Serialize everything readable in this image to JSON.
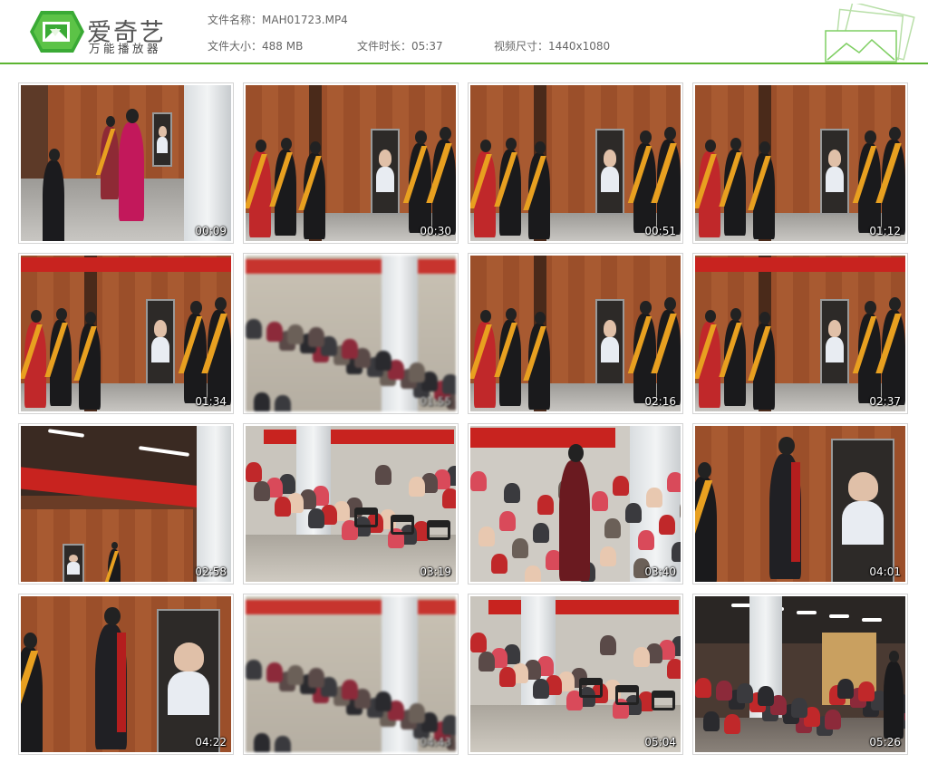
{
  "app": {
    "title": "爱奇艺",
    "subtitle": "万能播放器"
  },
  "file": {
    "name_label": "文件名称：",
    "name": "MAH01723.MP4",
    "size_label": "文件大小：",
    "size": "488 MB",
    "duration_label": "文件时长：",
    "duration": "05:37",
    "dimensions_label": "视频尺寸：",
    "dimensions": "1440x1080"
  },
  "colors": {
    "accent": "#5cb531",
    "logo_green": "#3aaa35",
    "banner_red": "#c8231f",
    "wall_wood": "#a0522d"
  },
  "thumbnails": [
    {
      "time": "00:09",
      "scene": "entrance-walk"
    },
    {
      "time": "00:30",
      "scene": "clapping-line"
    },
    {
      "time": "00:51",
      "scene": "clapping-line"
    },
    {
      "time": "01:12",
      "scene": "clapping-line"
    },
    {
      "time": "01:34",
      "scene": "clapping-line-banner"
    },
    {
      "time": "01:55",
      "scene": "blurred-hall"
    },
    {
      "time": "02:16",
      "scene": "clapping-line"
    },
    {
      "time": "02:37",
      "scene": "clapping-line-banner"
    },
    {
      "time": "02:58",
      "scene": "tilted-ceiling"
    },
    {
      "time": "03:19",
      "scene": "seated-audience"
    },
    {
      "time": "03:40",
      "scene": "man-in-crowd"
    },
    {
      "time": "04:01",
      "scene": "man-high-five"
    },
    {
      "time": "04:22",
      "scene": "man-high-five"
    },
    {
      "time": "04:43",
      "scene": "blurred-hall"
    },
    {
      "time": "05:04",
      "scene": "seated-audience"
    },
    {
      "time": "05:26",
      "scene": "wide-hall"
    }
  ],
  "icons": {
    "logo": "iqiyi-logo-icon",
    "decoration": "photo-frames-icon"
  }
}
